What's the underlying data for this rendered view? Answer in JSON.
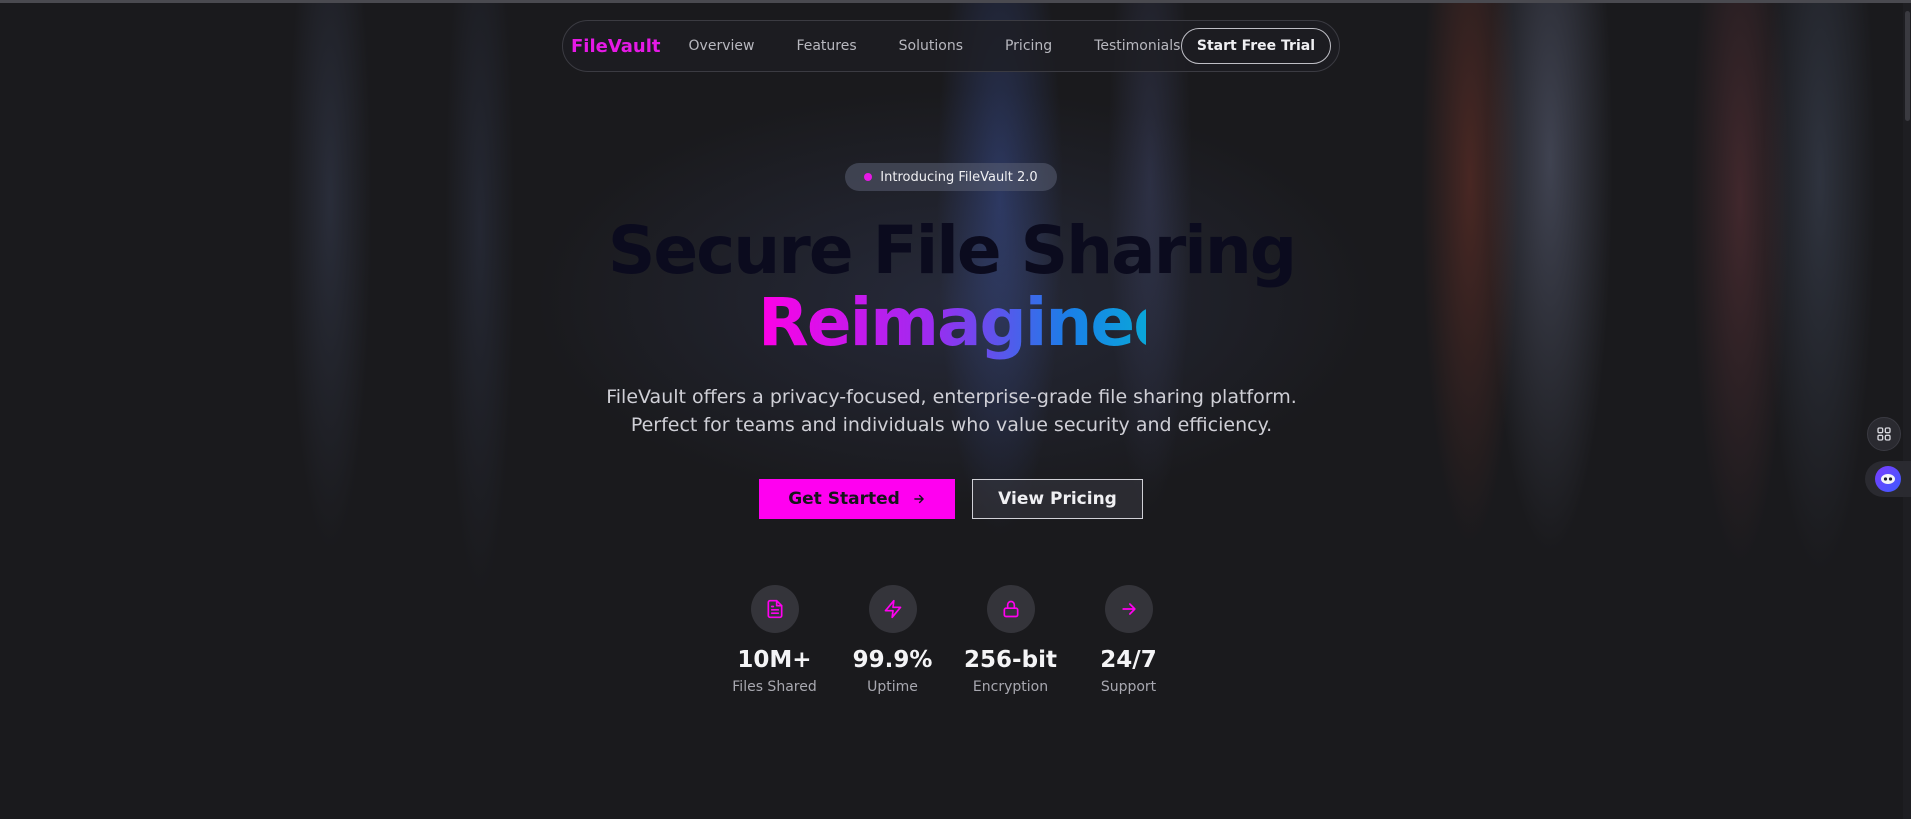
{
  "nav": {
    "brand": "FileVault",
    "links": [
      "Overview",
      "Features",
      "Solutions",
      "Pricing",
      "Testimonials"
    ],
    "cta": "Start Free Trial"
  },
  "hero": {
    "badge": "Introducing FileVault 2.0",
    "headline_line1": "Secure File Sharing",
    "headline_line2": "Reimagined",
    "subtext_line1": "FileVault offers a privacy-focused, enterprise-grade file sharing platform.",
    "subtext_line2": "Perfect for teams and individuals who value security and efficiency.",
    "primary_button": "Get Started",
    "secondary_button": "View Pricing"
  },
  "stats": [
    {
      "icon": "file-icon",
      "value": "10M+",
      "label": "Files Shared"
    },
    {
      "icon": "lightning-icon",
      "value": "99.9%",
      "label": "Uptime"
    },
    {
      "icon": "lock-icon",
      "value": "256-bit",
      "label": "Encryption"
    },
    {
      "icon": "arrow-right-icon",
      "value": "24/7",
      "label": "Support"
    }
  ],
  "colors": {
    "accent": "#ff00f0",
    "brand": "#e619e6",
    "background": "#1a1a1d"
  }
}
